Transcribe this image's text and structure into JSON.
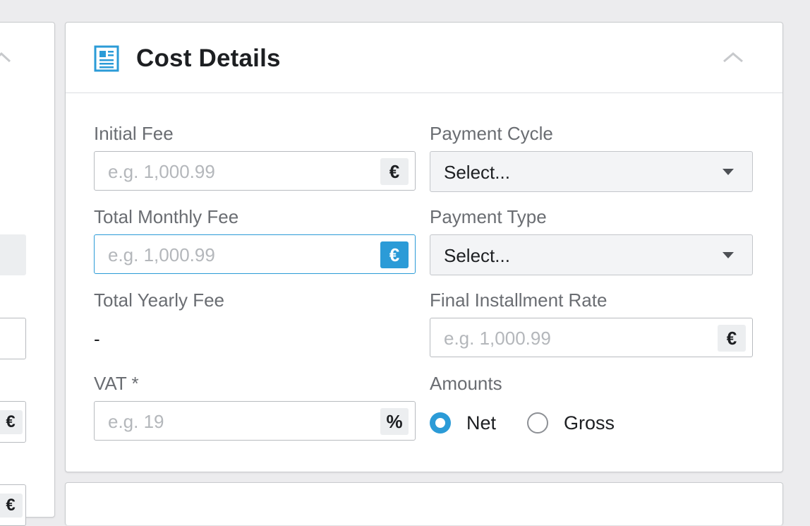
{
  "cost_details": {
    "title": "Cost Details",
    "initial_fee": {
      "label": "Initial Fee",
      "placeholder": "e.g. 1,000.99",
      "currency": "€"
    },
    "total_monthly_fee": {
      "label": "Total Monthly Fee",
      "placeholder": "e.g. 1,000.99",
      "currency": "€"
    },
    "total_yearly_fee": {
      "label": "Total Yearly Fee",
      "value": "-"
    },
    "vat": {
      "label": "VAT *",
      "placeholder": "e.g. 19",
      "unit": "%"
    },
    "payment_cycle": {
      "label": "Payment Cycle",
      "selected": "Select..."
    },
    "payment_type": {
      "label": "Payment Type",
      "selected": "Select..."
    },
    "final_installment_rate": {
      "label": "Final Installment Rate",
      "placeholder": "e.g. 1,000.99",
      "currency": "€"
    },
    "amounts": {
      "label": "Amounts",
      "options": [
        {
          "label": "Net",
          "selected": true
        },
        {
          "label": "Gross",
          "selected": false
        }
      ]
    }
  },
  "left_panel": {
    "currency_1": "€",
    "currency_2": "€"
  },
  "colors": {
    "accent": "#2b9bd7",
    "background": "#ececee",
    "border": "#b8bbbf"
  },
  "icons": [
    "document-icon",
    "chevron-up-icon",
    "euro-icon",
    "percent-icon",
    "dropdown-caret-icon"
  ]
}
